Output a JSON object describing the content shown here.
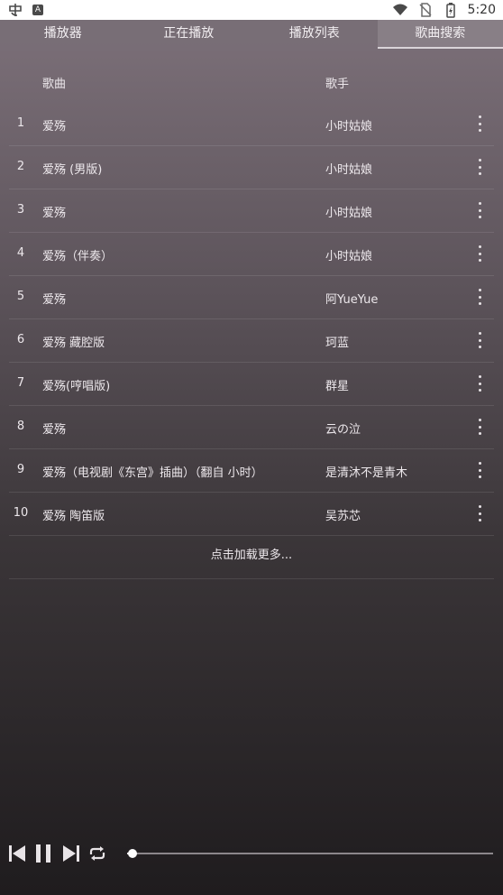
{
  "status_bar": {
    "time": "5:20",
    "left_icons": [
      "notification-app-icon",
      "keyboard-a-icon"
    ],
    "right_icons": [
      "wifi-icon",
      "no-sim-icon",
      "battery-charging-icon"
    ]
  },
  "tabs": [
    {
      "label": "播放器",
      "active": false
    },
    {
      "label": "正在播放",
      "active": false
    },
    {
      "label": "播放列表",
      "active": false
    },
    {
      "label": "歌曲搜索",
      "active": true
    }
  ],
  "list": {
    "header": {
      "song": "歌曲",
      "artist": "歌手"
    },
    "rows": [
      {
        "index": "1",
        "title": "爱殇",
        "artist": "小时姑娘"
      },
      {
        "index": "2",
        "title": "爱殇 (男版)",
        "artist": "小时姑娘"
      },
      {
        "index": "3",
        "title": "爱殇",
        "artist": "小时姑娘"
      },
      {
        "index": "4",
        "title": "爱殇（伴奏）",
        "artist": "小时姑娘"
      },
      {
        "index": "5",
        "title": "爱殇",
        "artist": "阿YueYue"
      },
      {
        "index": "6",
        "title": "爱殇 藏腔版",
        "artist": "珂蓝"
      },
      {
        "index": "7",
        "title": "爱殇(哼唱版)",
        "artist": "群星"
      },
      {
        "index": "8",
        "title": "爱殇",
        "artist": "云の泣"
      },
      {
        "index": "9",
        "title": "爱殇（电视剧《东宫》插曲）（翻自 小时）",
        "artist": "是清沐不是青木"
      },
      {
        "index": "10",
        "title": "爱殇 陶笛版",
        "artist": "吴苏芯"
      }
    ],
    "load_more": "点击加载更多..."
  },
  "player": {
    "controls": [
      "previous-icon",
      "pause-icon",
      "next-icon",
      "repeat-icon"
    ],
    "progress": 0.015
  },
  "colors": {
    "gradient_top": "#7c7079",
    "gradient_bottom": "#1f1c1e",
    "text": "#ede8ec"
  }
}
